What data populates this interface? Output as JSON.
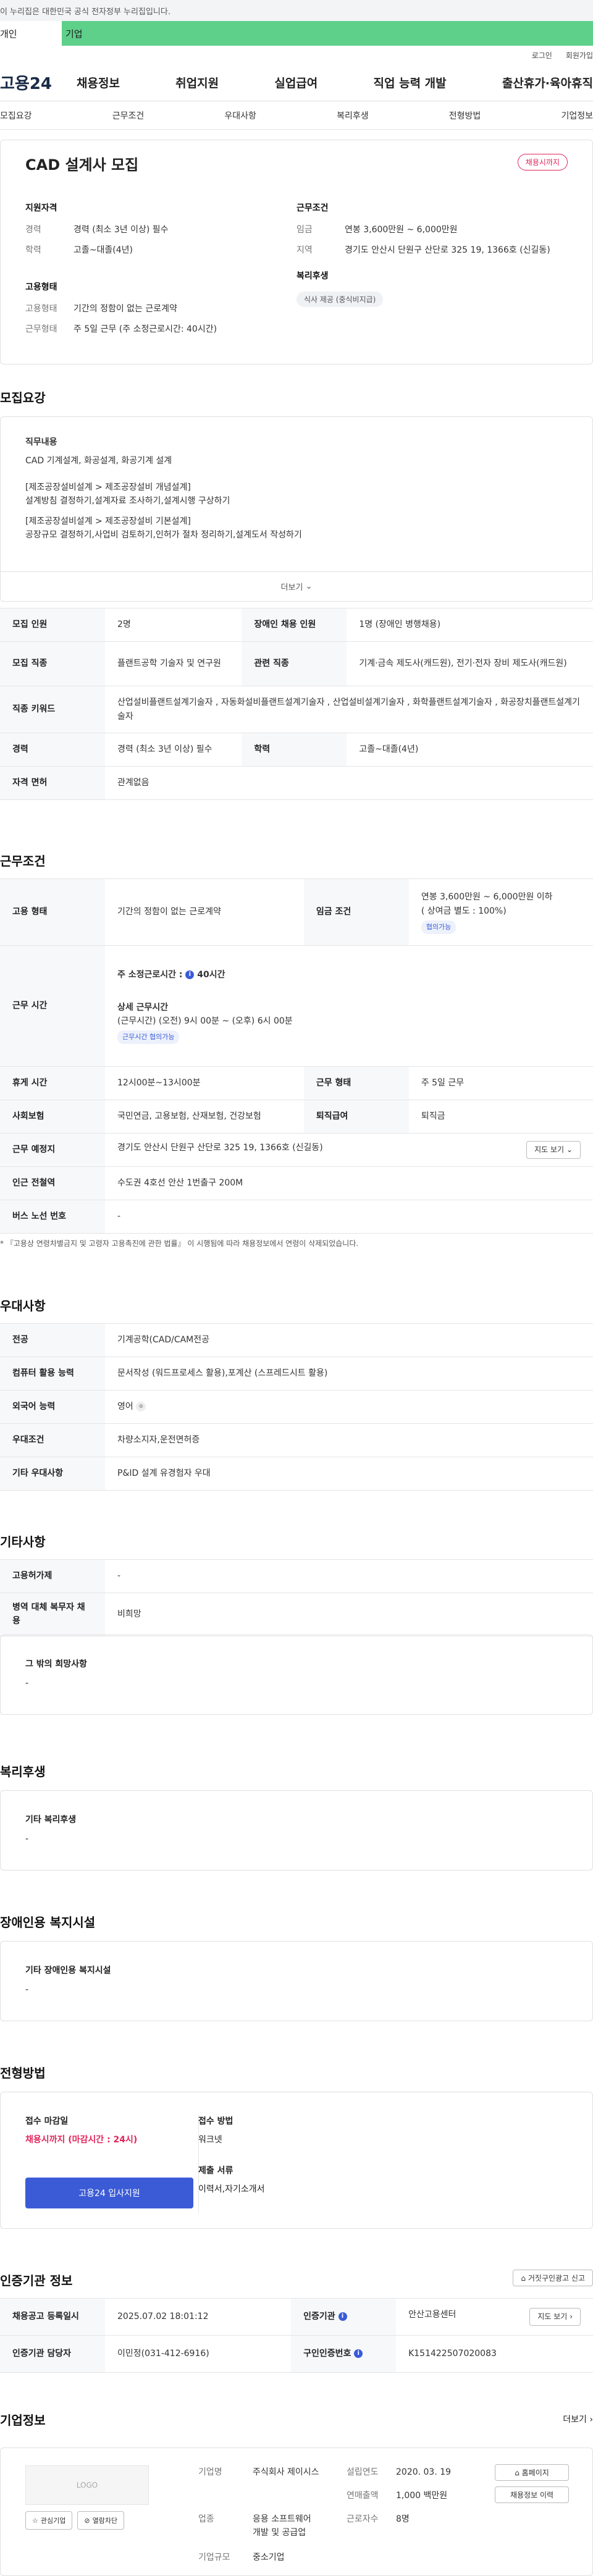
{
  "header": {
    "gov_notice": "이 누리집은 대한민국 공식 전자정부 누리집입니다.",
    "tab_person": "개인",
    "tab_business": "기업",
    "login": "로그인",
    "signup": "회원가입",
    "logo": "고용24",
    "gnb": [
      "채용정보",
      "취업지원",
      "실업급여",
      "직업 능력 개발",
      "출산휴가·육아휴직"
    ],
    "subtabs": [
      "모집요강",
      "근무조건",
      "우대사항",
      "복리후생",
      "전형방법",
      "기업정보"
    ]
  },
  "summary": {
    "title": "CAD 설계사 모집",
    "status": "채용시까지",
    "qual_head": "지원자격",
    "career_k": "경력",
    "career_v": "경력 (최소 3년 이상) 필수",
    "edu_k": "학력",
    "edu_v": "고졸~대졸(4년)",
    "cond_head": "근무조건",
    "wage_k": "임금",
    "wage_v": "연봉 3,600만원 ~ 6,000만원",
    "loc_k": "지역",
    "loc_v": "경기도 안산시 단원구 산단로 325 19, 1366호 (신길동)",
    "emp_head": "고용형태",
    "type_k": "고용형태",
    "type_v": "기간의 정함이 없는 근로계약",
    "work_k": "근무형태",
    "work_v": "주 5일 근무 (주 소정근로시간: 40시간)",
    "welfare_head": "복리후생",
    "welfare_chip": "식사 제공 (중식비지급)"
  },
  "recruit": {
    "section_title": "모집요강",
    "duty_head": "직무내용",
    "duty_line1": "CAD 기계설계, 화공설계, 화공기계 설계",
    "duty_p1a": "[제조공장설비설계 > 제조공장설비 개념설계]",
    "duty_p1b": "설계방침 결정하기,설계자료 조사하기,설계시행 구상하기",
    "duty_p2a": "[제조공장설비설계 > 제조공장설비 기본설계]",
    "duty_p2b": "공장규모 결정하기,사업비 검토하기,인허가 절차 정리하기,설계도서 작성하기",
    "more": "더보기",
    "rows": {
      "count_k": "모집 인원",
      "count_v": "2명",
      "disabled_k": "장애인 채용 인원",
      "disabled_v": "1명 (장애인 병행채용)",
      "job_k": "모집 직종",
      "job_v": "플랜트공학 기술자 및 연구원",
      "related_k": "관련 직종",
      "related_v": "기계·금속 제도사(캐드원), 전기·전자 장비 제도사(캐드원)",
      "keyword_k": "직종 키워드",
      "keyword_v": "산업설비플랜트설계기술자 , 자동화설비플랜트설계기술자 , 산업설비설계기술자 , 화학플랜트설계기술자 , 화공장치플랜트설계기술자",
      "career_k": "경력",
      "career_v": "경력 (최소 3년 이상) 필수",
      "edu_k": "학력",
      "edu_v": "고졸~대졸(4년)",
      "license_k": "자격 면허",
      "license_v": "관계없음"
    }
  },
  "conditions": {
    "section_title": "근무조건",
    "type_k": "고용 형태",
    "type_v": "기간의 정함이 없는 근로계약",
    "wage_k": "임금 조건",
    "wage_v1": "연봉 3,600만원 ~ 6,000만원 이하",
    "wage_v2": "( 상여금 별도 : 100%)",
    "wage_chip": "협의가능",
    "hours_k": "근무 시간",
    "hours_week": "주 소정근로시간 :",
    "hours_week_val": "40시간",
    "hours_detail_h": "상세 근무시간",
    "hours_detail": "(근무시간) (오전) 9시 00분 ~ (오후) 6시 00분",
    "hours_chip": "근무시간 협의가능",
    "break_k": "휴게 시간",
    "break_v": "12시00분~13시00분",
    "form_k": "근무 형태",
    "form_v": "주 5일 근무",
    "insurance_k": "사회보험",
    "insurance_v": "국민연금, 고용보험, 산재보험, 건강보험",
    "retire_k": "퇴직급여",
    "retire_v": "퇴직금",
    "addr_k": "근무 예정지",
    "addr_v": "경기도 안산시 단원구 산단로 325 19, 1366호 (신길동)",
    "map_btn": "지도 보기",
    "subway_k": "인근 전철역",
    "subway_v": "수도권 4호선 안산 1번출구 200M",
    "bus_k": "버스 노선 번호",
    "bus_v": "-",
    "note": "* 『고용상 연령차별금지 및 고령자 고용촉진에 관한 법률』 이 시행됨에 따라 채용정보에서 연령이 삭제되었습니다."
  },
  "preference": {
    "section_title": "우대사항",
    "major_k": "전공",
    "major_v": "기계공학(CAD/CAM전공",
    "pc_k": "컴퓨터 활용 능력",
    "pc_v": "문서작성 (워드프로세스 활용),포계산 (스프레드시트 활용)",
    "lang_k": "외국어 능력",
    "lang_v": "영어",
    "cond_k": "우대조건",
    "cond_v": "차량소지자,운전면허증",
    "etc_k": "기타 우대사항",
    "etc_v": "P&ID 설계 유경험자 우대"
  },
  "other": {
    "section_title": "기타사항",
    "period_k": "고용허가제",
    "period_v": "-",
    "military_k": "병역 대체 복무자 채용",
    "military_v": "비희망",
    "wish_h": "그 밖의 희망사항",
    "wish_v": "-"
  },
  "welfare": {
    "section_title": "복리후생",
    "h": "기타 복리후생",
    "v": "-"
  },
  "disabled": {
    "section_title": "장애인용 복지시설",
    "h": "기타 장애인용 복지시설",
    "v": "-"
  },
  "apply": {
    "section_title": "전형방법",
    "deadline_h": "접수 마감일",
    "deadline_v": "채용시까지 (마감시간 : 24시)",
    "btn": "고용24 입사지원",
    "method_h": "접수 방법",
    "method_v": "워크넷",
    "docs_h": "제출 서류",
    "docs_v": "이력서,자기소개서"
  },
  "certify": {
    "section_title": "인증기관 정보",
    "report_btn": "거짓구인광고 신고",
    "reg_k": "채용공고 등록일시",
    "reg_v": "2025.07.02 18:01:12",
    "agency_k": "인증기관",
    "agency_v": "안산고용센터",
    "map_btn": "지도 보기",
    "manager_k": "인증기관 담당자",
    "manager_v": "이민정(031-412-6916)",
    "num_k": "구인인증번호",
    "num_v": "K151422507020083"
  },
  "company": {
    "section_title": "기업정보",
    "more": "더보기",
    "logo": "LOGO",
    "fav_btn": "관심기업",
    "block_btn": "열람차단",
    "name_k": "기업명",
    "name_v": "주식회사 제이시스",
    "industry_k": "업종",
    "industry_v": "응용 소프트웨어 개발 및 공급업",
    "size_k": "기업규모",
    "size_v": "중소기업",
    "year_k": "설립연도",
    "year_v": "2020. 03. 19",
    "sales_k": "연매출액",
    "sales_v": "1,000 백만원",
    "staff_k": "근로자수",
    "staff_v": "8명",
    "homepage_btn": "홈페이지",
    "jobs_btn": "채용정보 이력"
  }
}
